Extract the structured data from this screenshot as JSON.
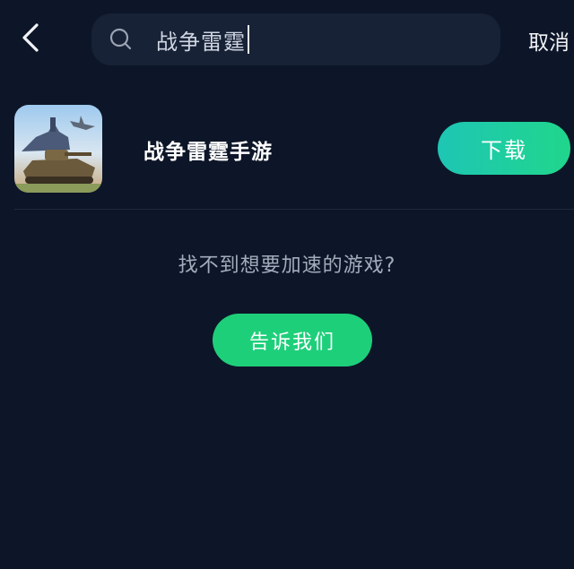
{
  "top_bar": {
    "back_icon": "chevron-left-icon",
    "search": {
      "icon": "search-icon",
      "value": "战争雷霆"
    },
    "cancel_label": "取消"
  },
  "result": {
    "game_name": "战争雷霆手游",
    "download_label": "下载"
  },
  "empty_hint": {
    "text": "找不到想要加速的游戏?",
    "tell_us_label": "告诉我们"
  },
  "colors": {
    "background": "#0d1628",
    "search_bg": "#172236",
    "accent_green": "#1ecf7a",
    "download_gradient_start": "#1ec6b4",
    "download_gradient_end": "#20d68c"
  }
}
